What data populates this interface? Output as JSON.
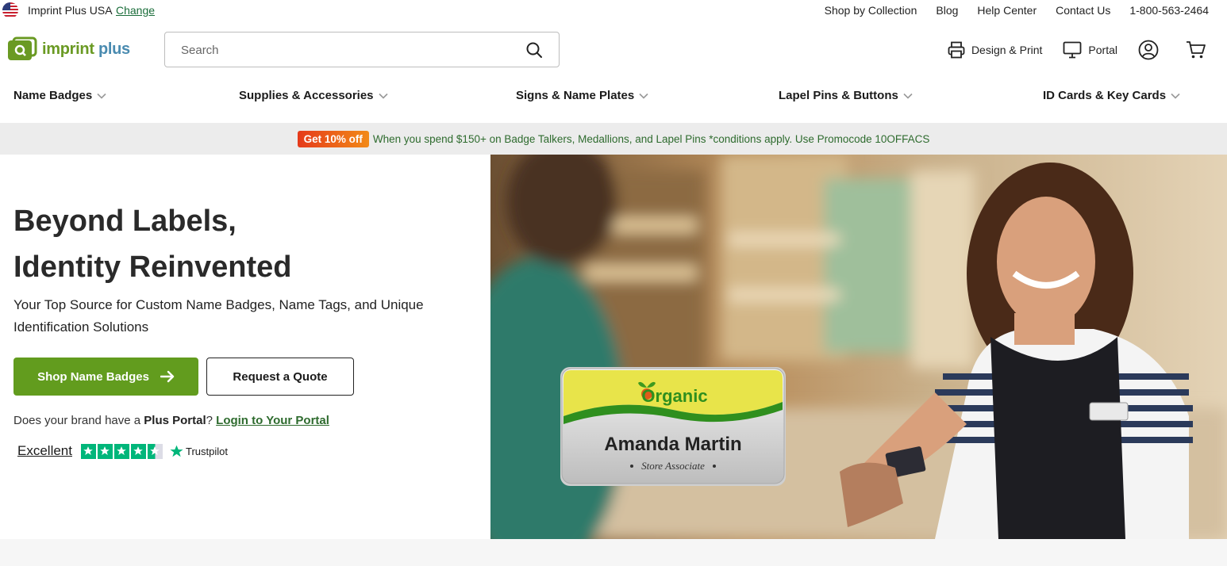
{
  "topbar": {
    "region": "Imprint Plus USA",
    "change": "Change",
    "links": [
      "Shop by Collection",
      "Blog",
      "Help Center",
      "Contact Us",
      "1-800-563-2464"
    ]
  },
  "header": {
    "logo_text_a": "imprint",
    "logo_text_b": "plus",
    "search_placeholder": "Search",
    "design_print": "Design & Print",
    "portal": "Portal"
  },
  "nav": {
    "items": [
      "Name Badges",
      "Supplies & Accessories",
      "Signs & Name Plates",
      "Lapel Pins & Buttons",
      "ID Cards & Key Cards"
    ]
  },
  "promo": {
    "tag": "Get 10% off",
    "text": "When you spend $150+ on Badge Talkers, Medallions, and Lapel Pins *conditions apply. Use Promocode 10OFFACS"
  },
  "hero": {
    "title_line1": "Beyond Labels,",
    "title_line2": "Identity Reinvented",
    "subtitle": "Your Top Source for Custom Name Badges, Name Tags, and Unique Identification Solutions",
    "primary_button": "Shop Name Badges",
    "secondary_button": "Request a Quote",
    "portal_question": "Does your brand have a ",
    "portal_bold": "Plus Portal",
    "portal_q": "?",
    "portal_link": "Login to Your Portal",
    "trust_rating": "Excellent",
    "trust_brand": "Trustpilot",
    "trust_stars": 4.5
  },
  "badge": {
    "brand": "Organic",
    "name": "Amanda Martin",
    "role": "Store Associate"
  },
  "colors": {
    "accent_green": "#629c1e",
    "link_green": "#2e6b2e",
    "trustpilot": "#00b67a",
    "promo_bg": "#ececec"
  }
}
